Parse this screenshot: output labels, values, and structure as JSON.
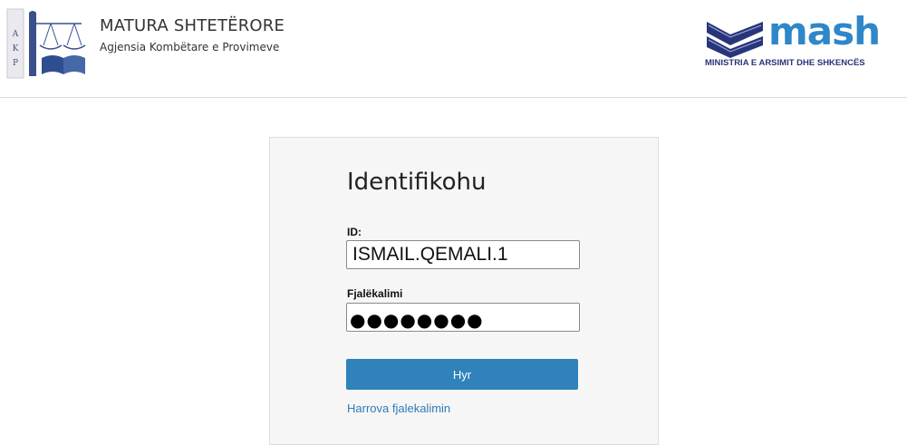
{
  "header": {
    "akp_logo_letters": [
      "A",
      "K",
      "P"
    ],
    "title": "MATURA SHTETËRORE",
    "subtitle": "Agjensia Kombëtare e Provimeve",
    "mash_word": "mash",
    "mash_subtitle": "MINISTRIA E ARSIMIT DHE SHKENCËS"
  },
  "login": {
    "title": "Identifikohu",
    "id_label": "ID:",
    "id_value": "ISMAIL.QEMALI.1",
    "password_label": "Fjalëkalimi",
    "password_masked": "●●●●●●●●",
    "submit_label": "Hyr",
    "forgot_label": "Harrova fjalekalimin"
  },
  "colors": {
    "button": "#2f82ba",
    "link": "#2e7bb8",
    "mash_blue": "#2f86c9",
    "mash_navy": "#29357a"
  }
}
